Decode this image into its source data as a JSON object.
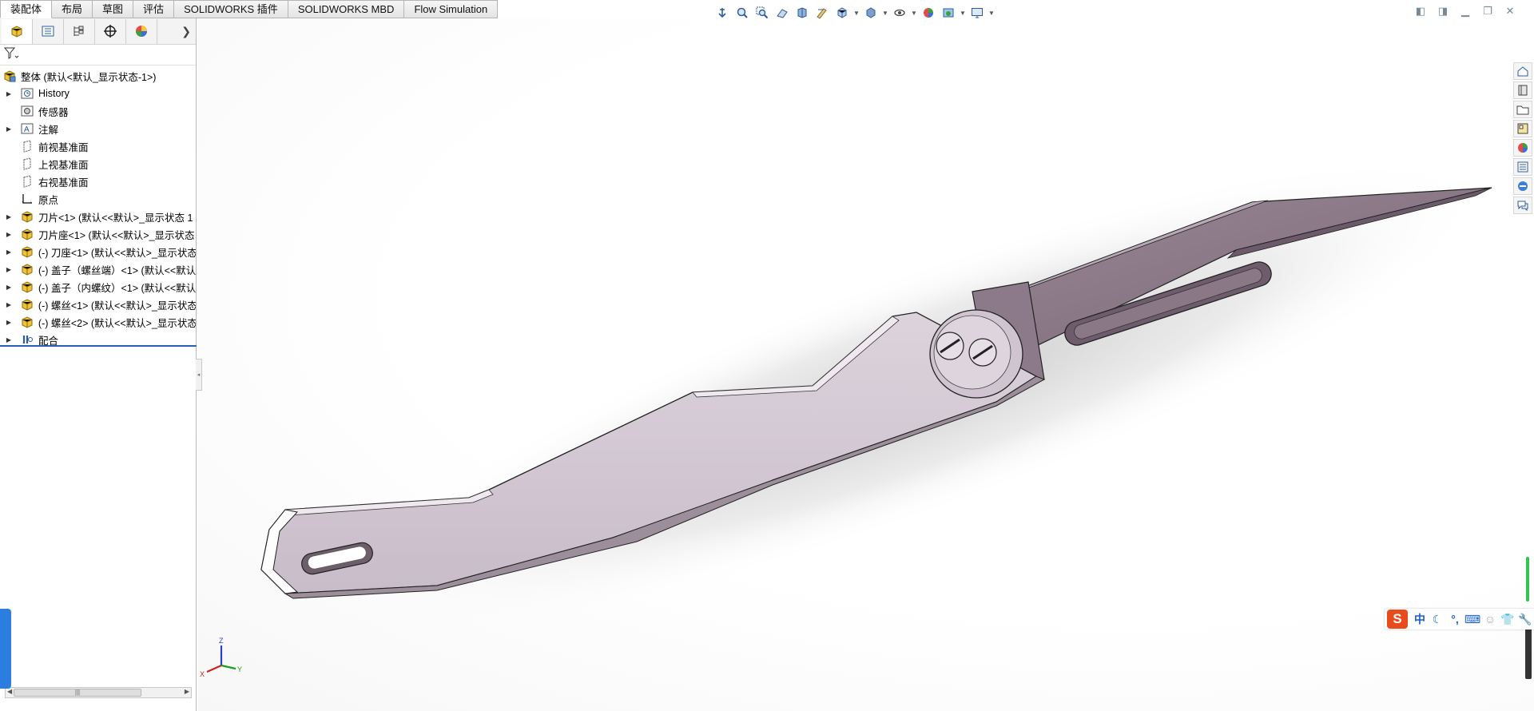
{
  "tabs": [
    {
      "label": "装配体",
      "active": true
    },
    {
      "label": "布局"
    },
    {
      "label": "草图"
    },
    {
      "label": "评估"
    },
    {
      "label": "SOLIDWORKS 插件"
    },
    {
      "label": "SOLIDWORKS MBD"
    },
    {
      "label": "Flow Simulation"
    }
  ],
  "hud_icons": [
    "anchor-icon",
    "zoom-fit-icon",
    "zoom-area-icon",
    "previous-view-icon",
    "section-view-icon",
    "dynamic-annotation-icon",
    "view-orientation-icon",
    "display-style-icon",
    "hide-show-icon",
    "edit-appearance-icon",
    "scene-icon",
    "view-settings-icon"
  ],
  "panel_tabs": [
    "feature-manager-icon",
    "property-manager-icon",
    "configuration-manager-icon",
    "dimxpert-icon",
    "display-manager-icon"
  ],
  "tree": {
    "root": "整体 (默认<默认_显示状态-1>)",
    "items": [
      {
        "label": "History",
        "icon": "history-icon",
        "expandable": true
      },
      {
        "label": "传感器",
        "icon": "sensor-icon",
        "expandable": false
      },
      {
        "label": "注解",
        "icon": "annotation-icon",
        "expandable": true
      },
      {
        "label": "前视基准面",
        "icon": "plane-icon",
        "expandable": false
      },
      {
        "label": "上视基准面",
        "icon": "plane-icon",
        "expandable": false
      },
      {
        "label": "右视基准面",
        "icon": "plane-icon",
        "expandable": false
      },
      {
        "label": "原点",
        "icon": "origin-icon",
        "expandable": false
      },
      {
        "label": "刀片<1> (默认<<默认>_显示状态 1",
        "icon": "part-icon",
        "expandable": true
      },
      {
        "label": "刀片座<1> (默认<<默认>_显示状态",
        "icon": "part-icon",
        "expandable": true
      },
      {
        "label": "(-) 刀座<1> (默认<<默认>_显示状态",
        "icon": "part-icon",
        "expandable": true
      },
      {
        "label": "(-) 盖子（螺丝端）<1> (默认<<默认",
        "icon": "part-icon",
        "expandable": true
      },
      {
        "label": "(-) 盖子（内螺纹）<1> (默认<<默认",
        "icon": "part-icon",
        "expandable": true
      },
      {
        "label": "(-) 螺丝<1> (默认<<默认>_显示状态",
        "icon": "part-icon",
        "expandable": true
      },
      {
        "label": "(-) 螺丝<2> (默认<<默认>_显示状态",
        "icon": "part-icon",
        "expandable": true
      },
      {
        "label": "配合",
        "icon": "mates-icon",
        "expandable": true
      }
    ]
  },
  "triad": {
    "z": "Z",
    "x": "X",
    "y": "Y"
  },
  "taskpane_icons": [
    "solidworks-resources-icon",
    "design-library-icon",
    "file-explorer-icon",
    "view-palette-icon",
    "appearances-icon",
    "custom-properties-icon",
    "solidworks-forum-icon",
    "chat-icon"
  ],
  "ime": {
    "lang": "中",
    "items": [
      "moon-icon",
      "punctuation-icon",
      "keyboard-icon",
      "user-icon",
      "skin-icon",
      "tools-icon"
    ]
  },
  "colors": {
    "accent": "#2a5fb8",
    "part_light": "#d6ccd6",
    "part_mid": "#b8a9b8",
    "part_dark": "#8a7888"
  }
}
